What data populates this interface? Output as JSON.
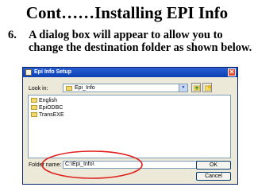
{
  "slide": {
    "title": "Cont……Installing EPI Info",
    "step_number": "6.",
    "step_text": "A dialog box will appear to allow you to change the destination folder as shown below."
  },
  "dialog": {
    "title": "Epi Info Setup",
    "close_glyph": "✕",
    "look_in_label": "Look in:",
    "look_in_value": "Epi_Info",
    "folders": [
      "English",
      "EpiODBC",
      "TransEXE"
    ],
    "folder_name_label": "Folder name:",
    "folder_name_value": "C:\\Epi_Info\\",
    "ok_label": "OK",
    "cancel_label": "Cancel"
  },
  "colors": {
    "titlebar": "#0b3fb4",
    "highlight_ellipse": "#e0201c",
    "dialog_bg": "#ece9d8"
  },
  "icons": [
    "folder-icon",
    "up-folder-icon",
    "new-folder-icon",
    "close-icon"
  ]
}
